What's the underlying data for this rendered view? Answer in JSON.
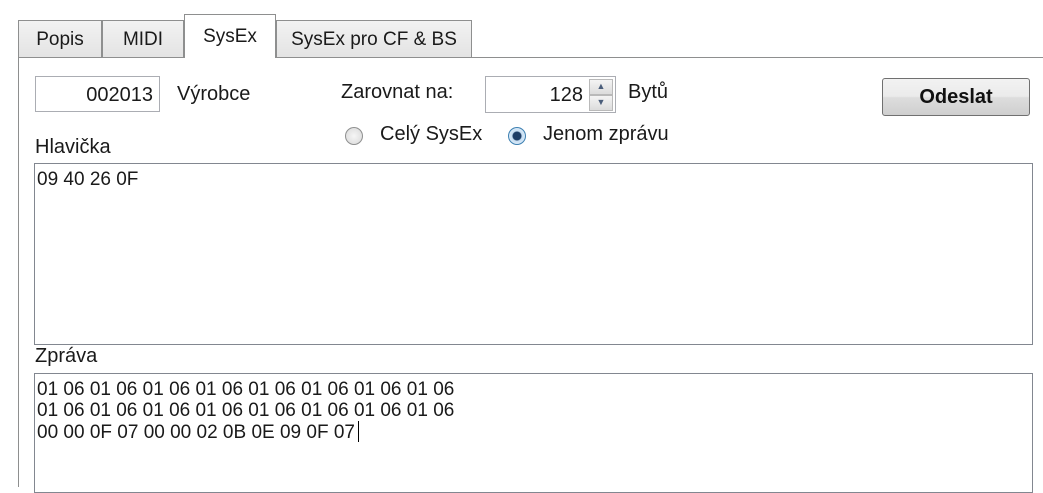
{
  "tabs": [
    {
      "label": "Popis",
      "active": false
    },
    {
      "label": "MIDI",
      "active": false
    },
    {
      "label": "SysEx",
      "active": true
    },
    {
      "label": "SysEx pro CF & BS",
      "active": false
    }
  ],
  "manufacturer": {
    "value": "002013",
    "label": "Výrobce"
  },
  "align": {
    "label": "Zarovnat na:",
    "value": "128",
    "unit": "Bytů"
  },
  "send_button": {
    "label": "Odeslat"
  },
  "radios": [
    {
      "label": "Celý SysEx",
      "checked": false
    },
    {
      "label": "Jenom zprávu",
      "checked": true
    }
  ],
  "header": {
    "label": "Hlavička",
    "content": "09 40 26 0F"
  },
  "message": {
    "label": "Zpráva",
    "lines": [
      "01 06 01 06 01 06 01 06 01 06 01 06 01 06 01 06",
      "01 06 01 06 01 06 01 06 01 06 01 06 01 06 01 06",
      "00 00 0F 07 00 00 02 0B 0E 09 0F 07"
    ]
  }
}
